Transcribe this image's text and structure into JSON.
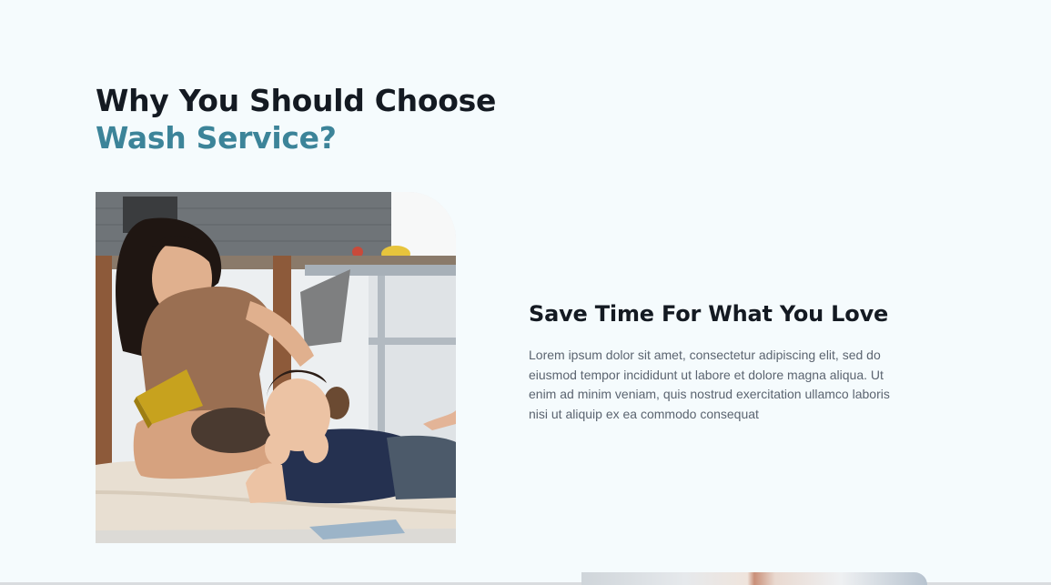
{
  "section": {
    "heading_line1": "Why You Should Choose",
    "heading_line2": "Wash Service?"
  },
  "feature": {
    "title": "Save Time For What You Love",
    "body": "Lorem ipsum dolor sit amet, consectetur adipiscing elit, sed do eiusmod tempor incididunt ut labore et dolore magna aliqua. Ut enim ad minim veniam, quis nostrud exercitation ullamco laboris nisi ut aliquip ex ea commodo consequat"
  },
  "colors": {
    "background": "#f5fbfd",
    "heading_dark": "#141a22",
    "heading_accent": "#3c8499",
    "body_text": "#5b6470"
  }
}
